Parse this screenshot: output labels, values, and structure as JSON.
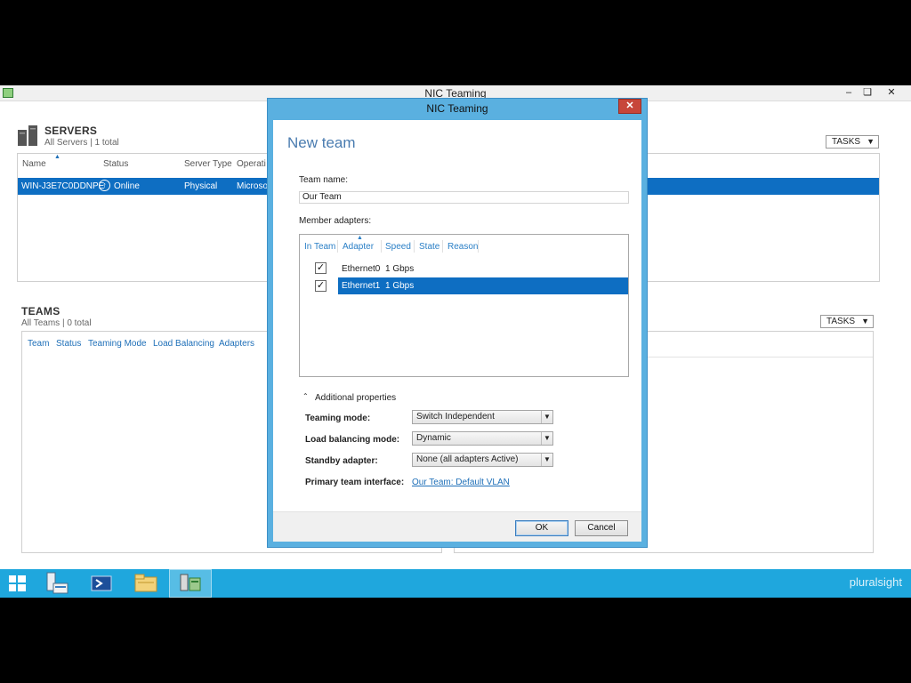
{
  "main_window": {
    "title": "NIC Teaming",
    "controls": {
      "minimize": "–",
      "restore": "❏",
      "close": "✕"
    }
  },
  "servers": {
    "title": "SERVERS",
    "subtitle": "All Servers | 1 total",
    "tasks_label": "TASKS",
    "columns": [
      "Name",
      "Status",
      "Server Type",
      "Operati"
    ],
    "rows": [
      {
        "name": "WIN-J3E7C0DDNPE",
        "status": "Online",
        "server_type": "Physical",
        "os": "Microso"
      }
    ]
  },
  "teams": {
    "title": "TEAMS",
    "subtitle": "All Teams | 0 total",
    "tasks_label": "TASKS",
    "columns": [
      "Team",
      "Status",
      "Teaming Mode",
      "Load Balancing",
      "Adapters"
    ]
  },
  "dialog": {
    "title": "NIC Teaming",
    "close_label": "✕",
    "heading": "New team",
    "team_name_label": "Team name:",
    "team_name_value": "Our Team",
    "member_adapters_label": "Member adapters:",
    "adapter_columns": [
      "In Team",
      "Adapter",
      "Speed",
      "State",
      "Reason"
    ],
    "adapters": [
      {
        "in_team": true,
        "adapter": "Ethernet0",
        "speed": "1 Gbps",
        "selected": false
      },
      {
        "in_team": true,
        "adapter": "Ethernet1",
        "speed": "1 Gbps",
        "selected": true
      }
    ],
    "additional_properties_label": "Additional properties",
    "teaming_mode_label": "Teaming mode:",
    "teaming_mode_value": "Switch Independent",
    "load_balancing_label": "Load balancing mode:",
    "load_balancing_value": "Dynamic",
    "standby_label": "Standby adapter:",
    "standby_value": "None (all adapters Active)",
    "primary_interface_label": "Primary team interface:",
    "primary_interface_value": "Our Team: Default VLAN",
    "ok_label": "OK",
    "cancel_label": "Cancel"
  },
  "taskbar": {
    "items": [
      "start-button",
      "server-manager",
      "powershell",
      "file-explorer",
      "nic-teaming"
    ],
    "brand": "pluralsight"
  },
  "colors": {
    "selection": "#0e6ec2",
    "dialog_frame": "#5ab0e0",
    "taskbar": "#1fa7dd",
    "link": "#1e6fb8",
    "close_button": "#c7463a"
  }
}
